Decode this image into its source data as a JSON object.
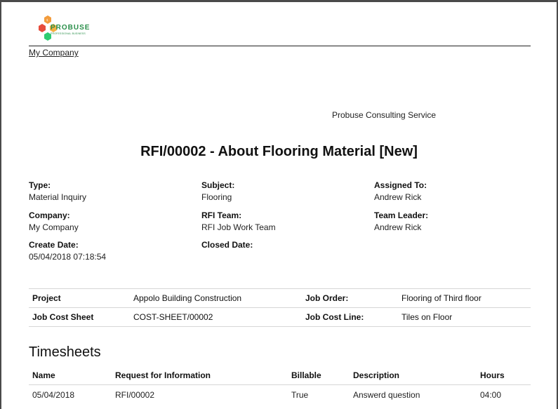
{
  "header": {
    "logo_text": "PROBUSE",
    "logo_tagline": "PROFESSIONAL BUSINESS",
    "company": "My Company",
    "consulting": "Probuse Consulting Service"
  },
  "title": "RFI/00002 - About Flooring Material [New]",
  "fields": {
    "type_label": "Type:",
    "type_value": "Material Inquiry",
    "subject_label": "Subject:",
    "subject_value": "Flooring",
    "assigned_label": "Assigned To:",
    "assigned_value": "Andrew Rick",
    "company_label": "Company:",
    "company_value": "My Company",
    "team_label": "RFI Team:",
    "team_value": "RFI Job Work Team",
    "leader_label": "Team Leader:",
    "leader_value": "Andrew Rick",
    "create_label": "Create Date:",
    "create_value": "05/04/2018 07:18:54",
    "closed_label": "Closed Date:",
    "closed_value": ""
  },
  "info_table": {
    "project_label": "Project",
    "project_value": "Appolo Building Construction",
    "job_order_label": "Job Order:",
    "job_order_value": "Flooring of Third floor",
    "cost_sheet_label": "Job Cost Sheet",
    "cost_sheet_value": "COST-SHEET/00002",
    "cost_line_label": "Job Cost Line:",
    "cost_line_value": "Tiles on Floor"
  },
  "timesheets": {
    "title": "Timesheets",
    "columns": [
      "Name",
      "Request for Information",
      "Billable",
      "Description",
      "Hours"
    ],
    "rows": [
      [
        "05/04/2018",
        "RFI/00002",
        "True",
        "Answerd question",
        "04:00"
      ]
    ]
  },
  "colors": {
    "logo_green": "#2a8f4a",
    "logo_orange": "#f39c3c",
    "logo_red": "#e74c3c"
  }
}
